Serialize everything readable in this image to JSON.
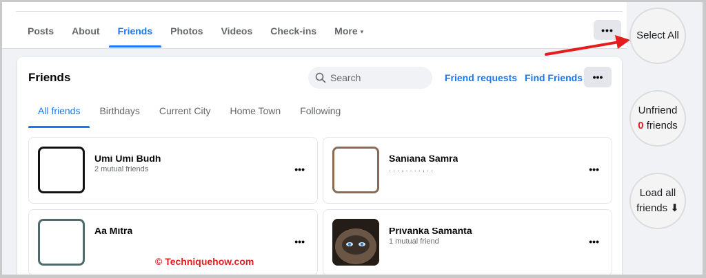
{
  "tabs": [
    {
      "label": "Posts",
      "active": false
    },
    {
      "label": "About",
      "active": false
    },
    {
      "label": "Friends",
      "active": true
    },
    {
      "label": "Photos",
      "active": false
    },
    {
      "label": "Videos",
      "active": false
    },
    {
      "label": "Check-ins",
      "active": false
    },
    {
      "label": "More",
      "active": false
    }
  ],
  "more_caret": "▾",
  "more_dots": "•••",
  "friends": {
    "title": "Friends",
    "search_placeholder": "Search",
    "friend_requests": "Friend requests",
    "find_friends": "Find Friends",
    "dots": "•••",
    "subtabs": [
      "All friends",
      "Birthdays",
      "Current City",
      "Home Town",
      "Following"
    ],
    "list": [
      {
        "name": "Umi Umi Budh",
        "sub": "2 mutual friends"
      },
      {
        "name": "Sanjana Samra",
        "sub": ". . . ,  .  . . . ,  . ."
      },
      {
        "name": "Aa Mitra",
        "sub": ""
      },
      {
        "name": "Priyanka Samanta",
        "sub": "1 mutual friend"
      }
    ]
  },
  "watermark": "© Techniquehow.com",
  "side": {
    "select_all": "Select All",
    "unfriend": "Unfriend",
    "unfriend_count": "0",
    "unfriend_suffix": "friends",
    "load_all_line1": "Load all",
    "load_all_line2": "friends ⬇"
  },
  "colors": {
    "accent": "#1877f2",
    "arrow": "#e41e1e",
    "count": "#e41e1e"
  }
}
